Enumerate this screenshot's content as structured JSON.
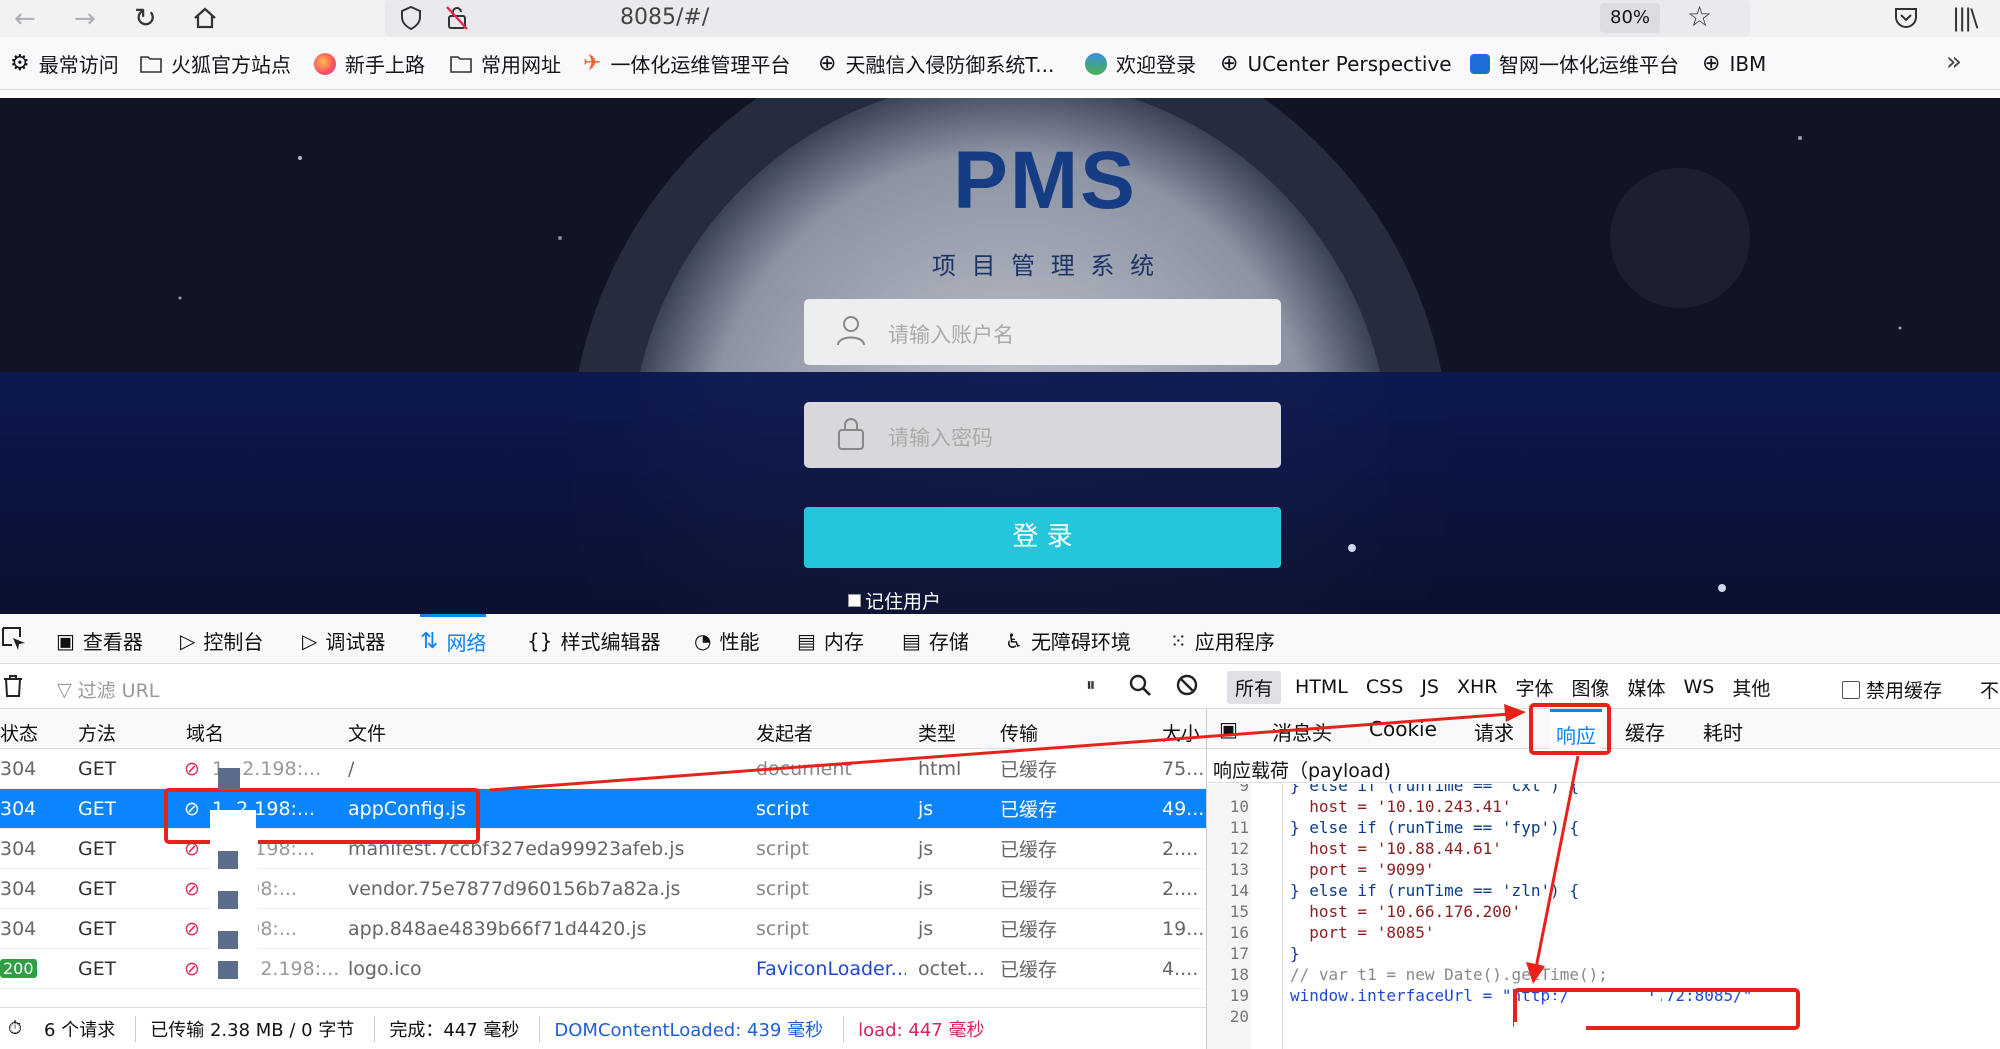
{
  "browser": {
    "url": "8085/#/",
    "zoom": "80%",
    "bookmarks": [
      "最常访问",
      "火狐官方站点",
      "新手上路",
      "常用网址",
      "一体化运维管理平台",
      "天融信入侵防御系统T...",
      "欢迎登录",
      "UCenter Perspective",
      "智网一体化运维平台",
      "IBM"
    ]
  },
  "login": {
    "logo": "PMS",
    "subtitle": "项 目 管 理 系 统",
    "username_placeholder": "请输入账户名",
    "password_placeholder": "请输入密码",
    "login_button": "登 录",
    "remember": "记住用户"
  },
  "devtools": {
    "tabs": [
      "查看器",
      "控制台",
      "调试器",
      "网络",
      "样式编辑器",
      "性能",
      "内存",
      "存储",
      "无障碍环境",
      "应用程序"
    ],
    "active_tab": "网络",
    "filter_placeholder": "过滤 URL",
    "type_filters": [
      "所有",
      "HTML",
      "CSS",
      "JS",
      "XHR",
      "字体",
      "图像",
      "媒体",
      "WS",
      "其他"
    ],
    "disable_cache": "禁用缓存",
    "no_throttle": "不",
    "columns": [
      "状态",
      "方法",
      "域名",
      "文件",
      "发起者",
      "类型",
      "传输",
      "大小"
    ],
    "rows": [
      {
        "status": "304",
        "method": "GET",
        "domain": "1...2.198:...",
        "file": "/",
        "initiator": "document",
        "type": "html",
        "transfer": "已缓存",
        "size": "75..."
      },
      {
        "status": "304",
        "method": "GET",
        "domain": "1  .2.198:...",
        "file": "appConfig.js",
        "initiator": "script",
        "type": "js",
        "transfer": "已缓存",
        "size": "49..."
      },
      {
        "status": "304",
        "method": "GET",
        "domain": "1  .2.198:...",
        "file": "manifest.7ccbf327eda99923afeb.js",
        "initiator": "script",
        "type": "js",
        "transfer": "已缓存",
        "size": "2...."
      },
      {
        "status": "304",
        "method": "GET",
        "domain": "  .2.198:...",
        "file": "vendor.75e7877d960156b7a82a.js",
        "initiator": "script",
        "type": "js",
        "transfer": "已缓存",
        "size": "2...."
      },
      {
        "status": "304",
        "method": "GET",
        "domain": "  .2.198:...",
        "file": "app.848ae4839b66f71d4420.js",
        "initiator": "script",
        "type": "js",
        "transfer": "已缓存",
        "size": "19..."
      },
      {
        "status": "200",
        "method": "GET",
        "domain": "1.23.2.198:...",
        "file": "logo.ico",
        "initiator": "FaviconLoader...",
        "type": "octet...",
        "transfer": "已缓存",
        "size": "4...."
      }
    ],
    "detail_tabs": [
      "消息头",
      "Cookie",
      "请求",
      "响应",
      "缓存",
      "耗时"
    ],
    "active_detail_tab": "响应",
    "payload_label": "响应载荷（payload)",
    "code_lines": [
      {
        "n": "9",
        "t": "} else if (runTime == 'cxl') {"
      },
      {
        "n": "10",
        "t": "  host = '10.10.243.41'"
      },
      {
        "n": "11",
        "t": "} else if (runTime == 'fyp') {"
      },
      {
        "n": "12",
        "t": "  host = '10.88.44.61'"
      },
      {
        "n": "13",
        "t": "  port = '9099'"
      },
      {
        "n": "14",
        "t": "} else if (runTime == 'zln') {"
      },
      {
        "n": "15",
        "t": "  host = '10.66.176.200'"
      },
      {
        "n": "16",
        "t": "  port = '8085'"
      },
      {
        "n": "17",
        "t": "}"
      },
      {
        "n": "18",
        "t": "// var t1 = new Date().getTime();"
      },
      {
        "n": "19",
        "t": "window.interfaceUrl = \"http:/        1.72:8085/\""
      },
      {
        "n": "20",
        "t": ""
      }
    ],
    "status": {
      "requests": "6 个请求",
      "transferred": "已传输 2.38 MB / 0 字节",
      "finish": "完成：447 毫秒",
      "dcl": "DOMContentLoaded: 439 毫秒",
      "load": "load: 447 毫秒"
    }
  },
  "colors": {
    "accent": "#0a84ff",
    "login_button": "#25c6dc",
    "annotation": "#e8221b"
  }
}
